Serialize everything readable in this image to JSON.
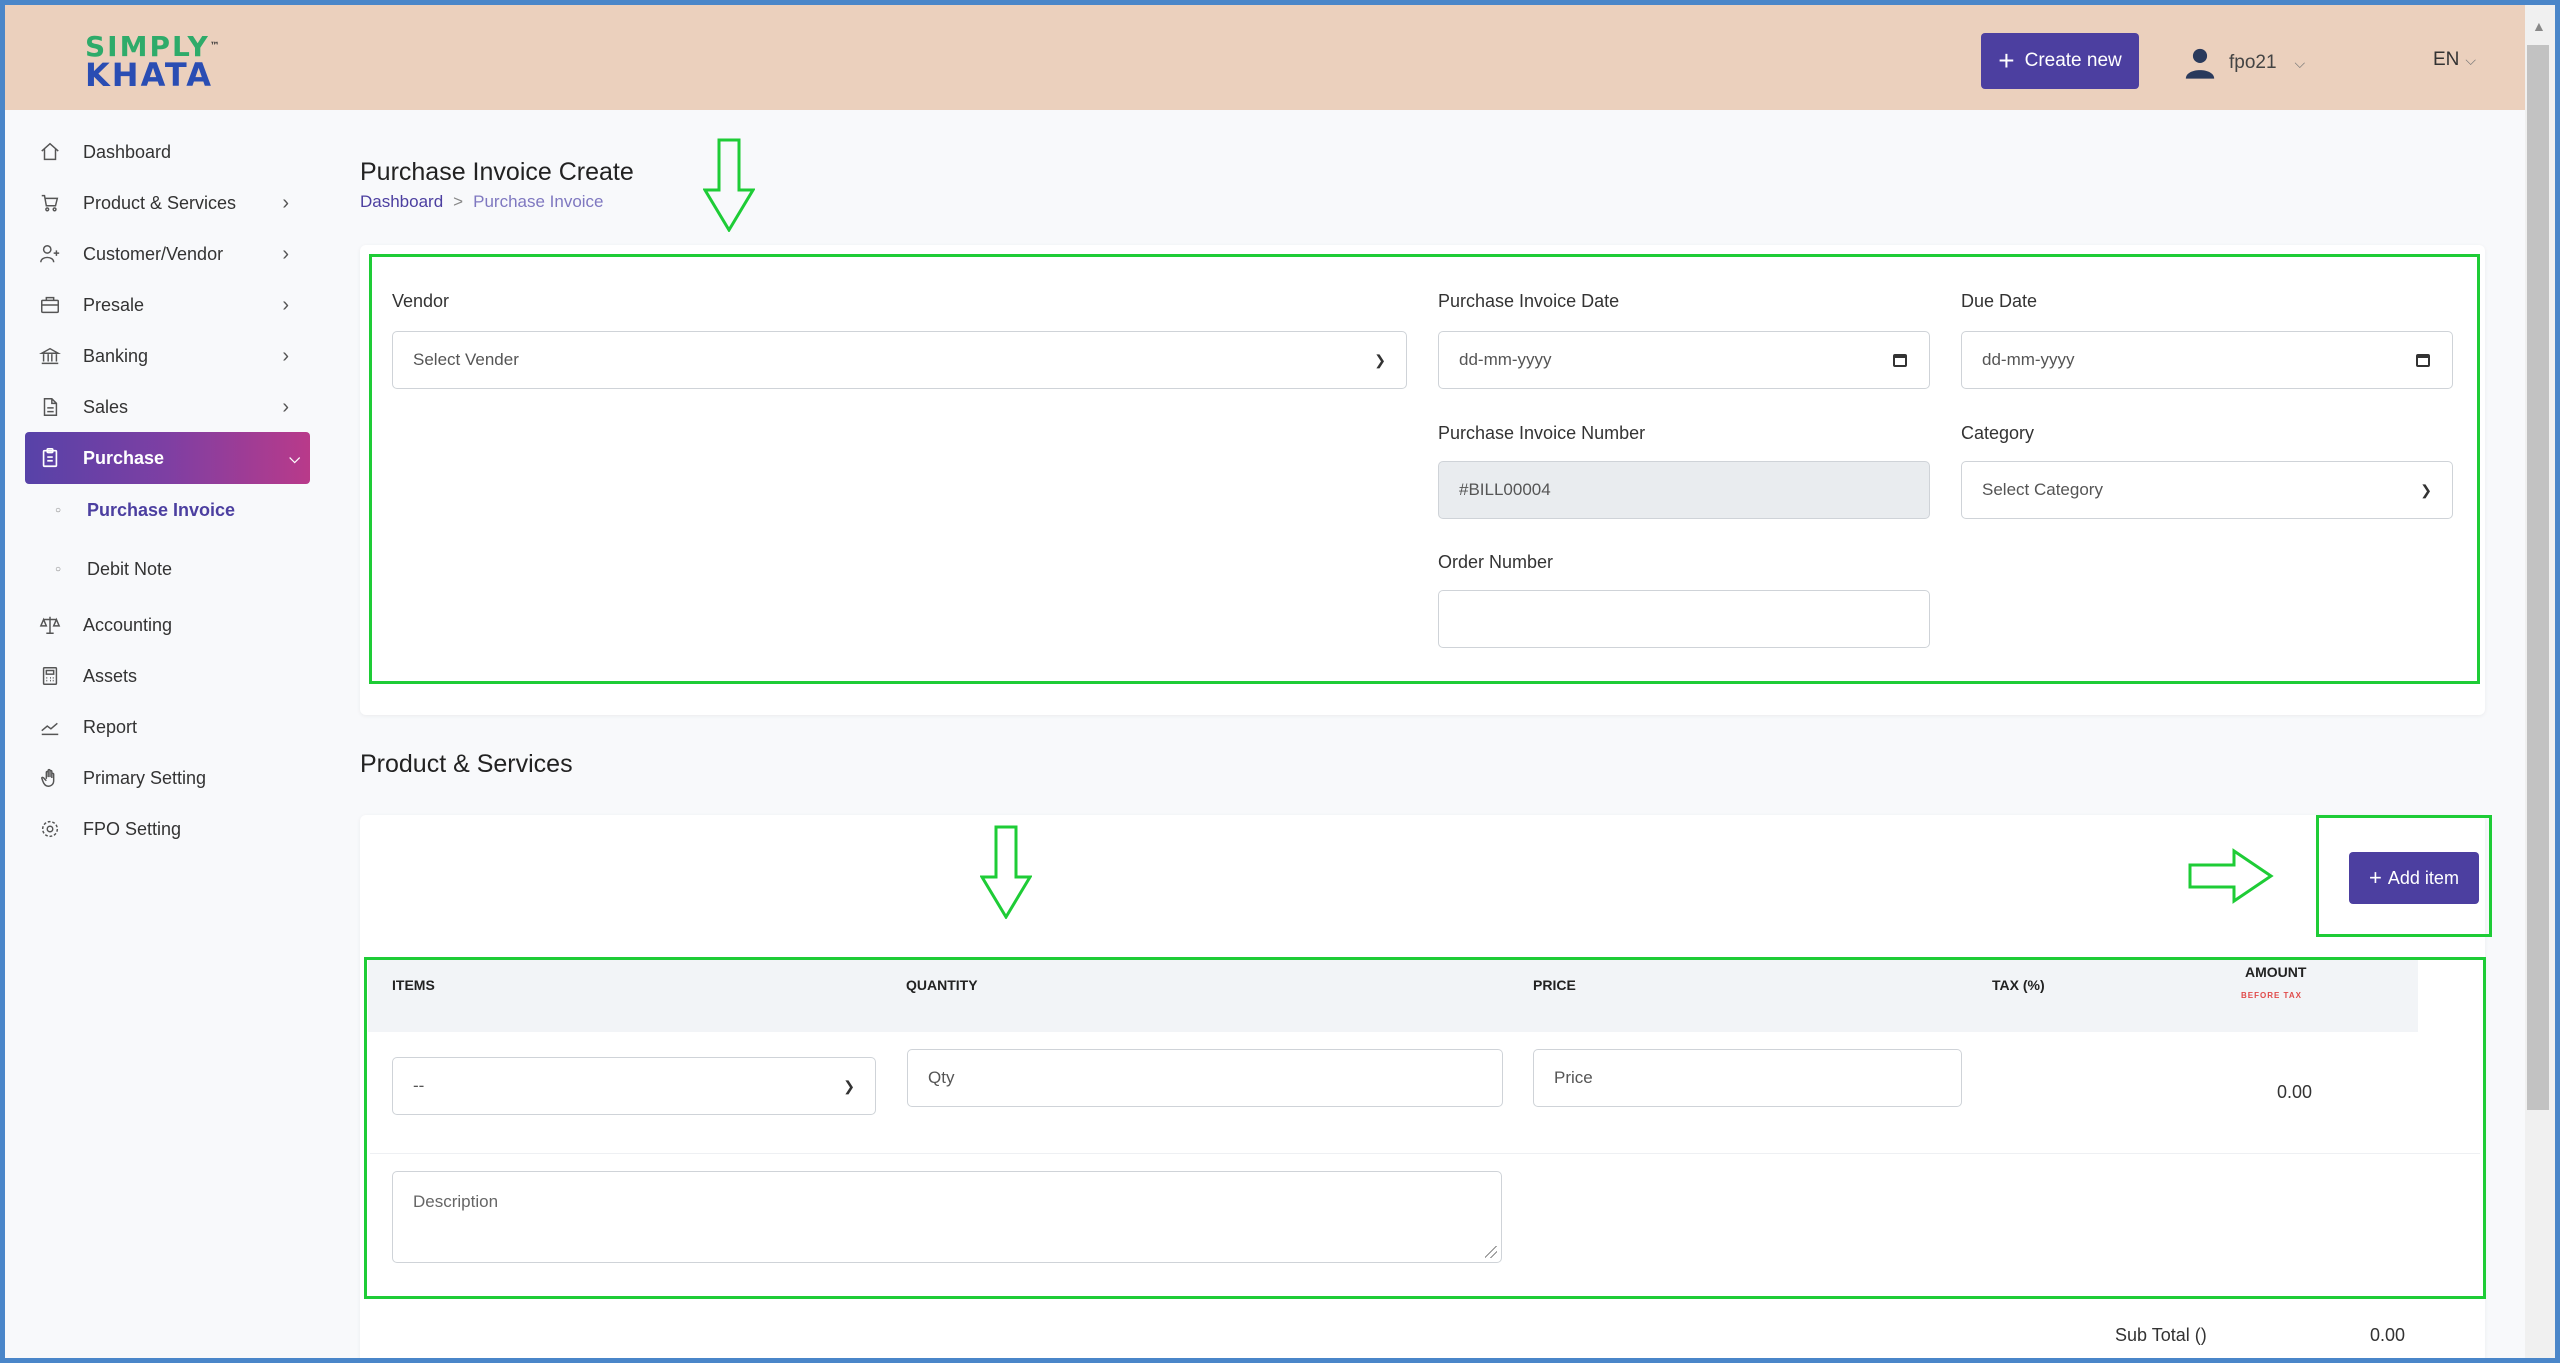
{
  "header": {
    "logo_line1": "SIMPLY",
    "logo_line2": "KHATA",
    "logo_tm": "™",
    "create_new_label": "Create new",
    "username": "fpo21",
    "language": "EN"
  },
  "sidebar": {
    "items": [
      {
        "label": "Dashboard",
        "icon": "home-icon"
      },
      {
        "label": "Product & Services",
        "icon": "cart-icon"
      },
      {
        "label": "Customer/Vendor",
        "icon": "user-plus-icon"
      },
      {
        "label": "Presale",
        "icon": "briefcase-icon"
      },
      {
        "label": "Banking",
        "icon": "bank-icon"
      },
      {
        "label": "Sales",
        "icon": "document-icon"
      },
      {
        "label": "Purchase",
        "icon": "clipboard-icon"
      },
      {
        "label": "Accounting",
        "icon": "scale-icon"
      },
      {
        "label": "Assets",
        "icon": "calculator-icon"
      },
      {
        "label": "Report",
        "icon": "chart-icon"
      },
      {
        "label": "Primary Setting",
        "icon": "hand-icon"
      },
      {
        "label": "FPO Setting",
        "icon": "gear-icon"
      }
    ],
    "purchase_sub": [
      {
        "label": "Purchase Invoice"
      },
      {
        "label": "Debit Note"
      }
    ]
  },
  "page": {
    "title": "Purchase Invoice Create",
    "breadcrumb_home": "Dashboard",
    "breadcrumb_sep": ">",
    "breadcrumb_current": "Purchase Invoice"
  },
  "form": {
    "vendor_label": "Vendor",
    "vendor_value": "Select Vender",
    "invoice_date_label": "Purchase Invoice Date",
    "invoice_date_placeholder": "dd-mm-yyyy",
    "due_date_label": "Due Date",
    "due_date_placeholder": "dd-mm-yyyy",
    "invoice_number_label": "Purchase Invoice Number",
    "invoice_number_value": "#BILL00004",
    "category_label": "Category",
    "category_value": "Select Category",
    "order_number_label": "Order Number",
    "order_number_value": ""
  },
  "products": {
    "section_title": "Product & Services",
    "add_item_label": "Add item",
    "columns": {
      "items": "ITEMS",
      "quantity": "QUANTITY",
      "price": "PRICE",
      "tax": "TAX (%)",
      "amount": "AMOUNT",
      "amount_sub": "BEFORE TAX"
    },
    "row": {
      "item_value": "--",
      "qty_placeholder": "Qty",
      "price_placeholder": "Price",
      "amount": "0.00",
      "description_placeholder": "Description"
    },
    "subtotal_label": "Sub Total ()",
    "subtotal_value": "0.00"
  },
  "colors": {
    "header_bg": "#ebd0bd",
    "primary": "#4c3fa0",
    "annotation": "#1ecc36"
  }
}
